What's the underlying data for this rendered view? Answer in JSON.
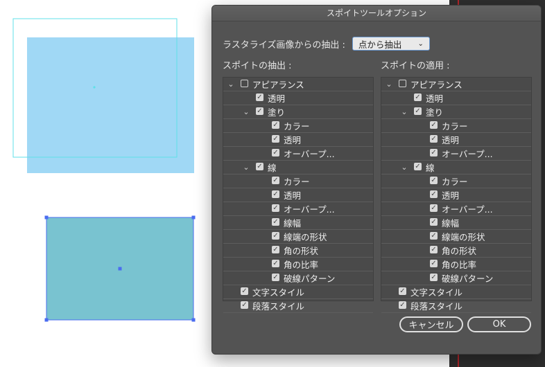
{
  "dialog": {
    "title": "スポイトツールオプション",
    "raster_label": "ラスタライズ画像からの抽出 :",
    "raster_value": "点から抽出",
    "left_title": "スポイトの抽出 :",
    "right_title": "スポイトの適用 :",
    "cancel": "キャンセル",
    "ok": "OK"
  },
  "tree": [
    {
      "label": "アピアランス",
      "level": 0,
      "twisty": true,
      "checked": false
    },
    {
      "label": "透明",
      "level": 1,
      "twisty": false,
      "checked": true
    },
    {
      "label": "塗り",
      "level": 1,
      "twisty": true,
      "checked": true
    },
    {
      "label": "カラー",
      "level": 2,
      "twisty": false,
      "checked": true
    },
    {
      "label": "透明",
      "level": 2,
      "twisty": false,
      "checked": true
    },
    {
      "label": "オーバープ...",
      "level": 2,
      "twisty": false,
      "checked": true
    },
    {
      "label": "線",
      "level": 1,
      "twisty": true,
      "checked": true
    },
    {
      "label": "カラー",
      "level": 2,
      "twisty": false,
      "checked": true
    },
    {
      "label": "透明",
      "level": 2,
      "twisty": false,
      "checked": true
    },
    {
      "label": "オーバープ...",
      "level": 2,
      "twisty": false,
      "checked": true
    },
    {
      "label": "線幅",
      "level": 2,
      "twisty": false,
      "checked": true
    },
    {
      "label": "線端の形状",
      "level": 2,
      "twisty": false,
      "checked": true
    },
    {
      "label": "角の形状",
      "level": 2,
      "twisty": false,
      "checked": true
    },
    {
      "label": "角の比率",
      "level": 2,
      "twisty": false,
      "checked": true
    },
    {
      "label": "破線パターン",
      "level": 2,
      "twisty": false,
      "checked": true
    },
    {
      "label": "文字スタイル",
      "level": 0,
      "twisty": false,
      "checked": true
    },
    {
      "label": "段落スタイル",
      "level": 0,
      "twisty": false,
      "checked": true
    }
  ],
  "colors": {
    "shape_light_blue": "#a0d8f5",
    "shape_teal": "#79c3d0",
    "outline_cyan": "#5fe0e8",
    "selection_blue": "#4a6cf0"
  }
}
